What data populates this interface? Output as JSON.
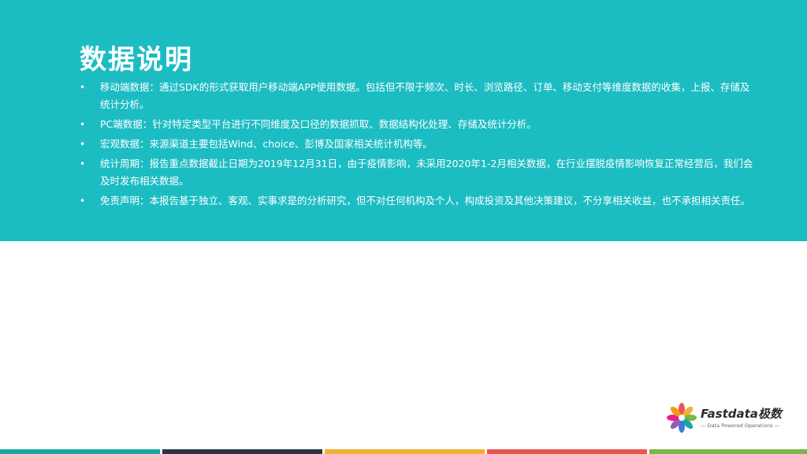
{
  "slide": {
    "title": "数据说明",
    "notes": [
      "移动端数据：通过SDK的形式获取用户移动端APP使用数据。包括但不限于频次、时长、浏览路径、订单、移动支付等维度数据的收集，上报、存储及统计分析。",
      "PC端数据：针对特定类型平台进行不同维度及口径的数据抓取、数据结构化处理、存储及统计分析。",
      "宏观数据：来源渠道主要包括Wind、choice、彭博及国家相关统计机构等。",
      "统计周期：报告重点数据截止日期为2019年12月31日，由于疫情影响，未采用2020年1-2月相关数据，在行业摆脱疫情影响恢复正常经营后，我们会及时发布相关数据。",
      "免责声明：本报告基于独立、客观、实事求是的分析研究，但不对任何机构及个人，构成投资及其他决策建议，不分享相关收益，也不承担相关责任。"
    ],
    "bullet": "•"
  },
  "logo": {
    "name": "Fastdata极数",
    "tagline": "— Data Powered Operations —"
  },
  "colors": {
    "banner": "#1cbcc3",
    "stripes": [
      "#1aa6a0",
      "#2b3440",
      "#f2b134",
      "#e8574e",
      "#7ab648"
    ]
  }
}
